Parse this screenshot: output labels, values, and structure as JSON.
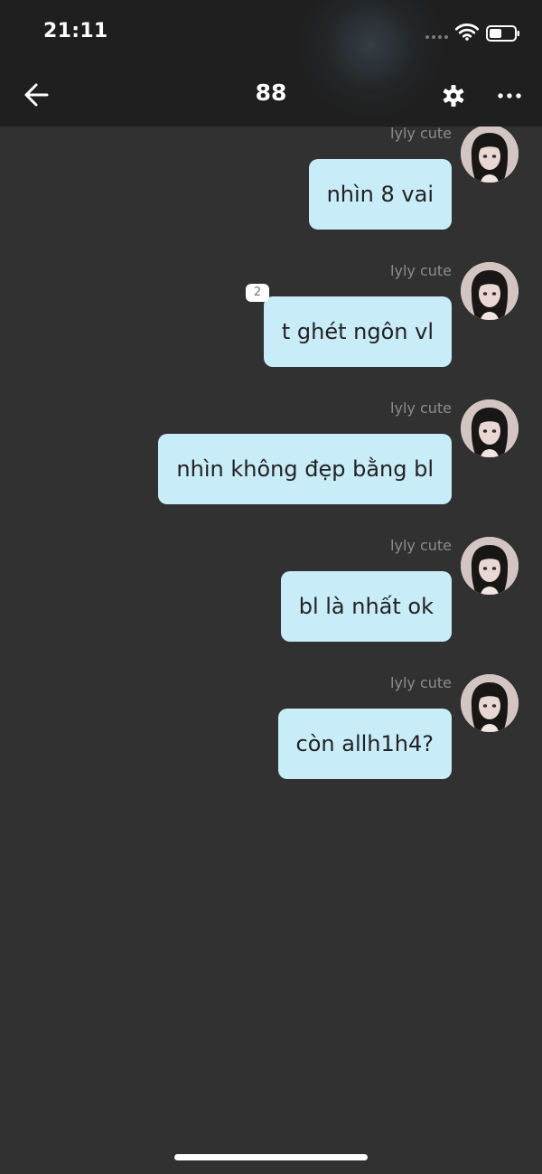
{
  "status_bar": {
    "time": "21:11",
    "wifi_icon": "wifi-icon",
    "battery_icon": "battery-icon"
  },
  "header": {
    "back_icon": "arrow-left-icon",
    "title": "88",
    "settings_icon": "gear-icon",
    "more_icon": "more-horizontal-icon"
  },
  "messages": [
    {
      "sender": "lyly cute",
      "text": "nhìn 8 vai"
    },
    {
      "sender": "lyly cute",
      "text": "t ghét ngôn vl",
      "badge": "2"
    },
    {
      "sender": "lyly cute",
      "text": "nhìn không đẹp bằng bl"
    },
    {
      "sender": "lyly cute",
      "text": "bl là nhất ok"
    },
    {
      "sender": "lyly cute",
      "text": "còn allh1h4?"
    }
  ],
  "colors": {
    "background": "#313131",
    "header": "#1f1f1f",
    "bubble": "#c9ecf9",
    "bubble_text": "#222222",
    "sender_text": "#8d8d8d"
  }
}
